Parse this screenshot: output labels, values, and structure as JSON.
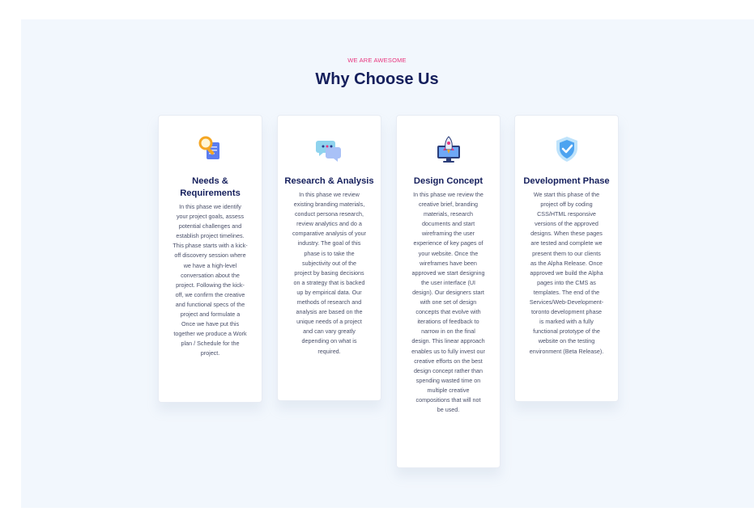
{
  "section": {
    "eyebrow": "WE ARE AWESOME",
    "title": "Why Choose Us"
  },
  "cards": [
    {
      "icon": "search-document-icon",
      "title": "Needs &\nRequirements",
      "text": "In this phase we identify\nyour project goals, assess\npotential challenges and\nestablish project timelines.\nThis phase starts with a kick-\noff discovery session where\nwe have a high-level\nconversation about the\nproject. Following the kick-\noff, we confirm the creative\nand functional specs of the\nproject and formulate a\nOnce we have put this\ntogether we produce a Work\nplan / Schedule for the\nproject."
    },
    {
      "icon": "chat-bubbles-icon",
      "title": "Research & Analysis",
      "text": "In this phase we review\nexisting branding materials,\nconduct persona research,\nreview analytics and do a\ncomparative analysis of your\nindustry. The goal of this\nphase is to take the\nsubjectivity out of the\nproject by basing decisions\non a strategy that is backed\nup by empirical data. Our\nmethods of research and\nanalysis are based on the\nunique needs of a project\nand can vary greatly\ndepending on what is\nrequired."
    },
    {
      "icon": "rocket-monitor-icon",
      "title": "Design Concept",
      "text": "In this phase we review the\ncreative brief, branding\nmaterials, research\ndocuments and start\nwireframing the user\nexperience of key pages of\nyour website. Once the\nwireframes have been\napproved we start designing\nthe user interface (UI\ndesign). Our designers start\nwith one set of design\nconcepts that evolve with\niterations of feedback to\nnarrow in on the final\ndesign. This linear approach\nenables us to fully invest our\ncreative efforts on the best\ndesign concept rather than\nspending wasted time on\nmultiple creative\ncompositions that will not\nbe used."
    },
    {
      "icon": "shield-check-icon",
      "title": "Development Phase",
      "text": "We start this phase of the\nproject off by coding\nCSS/HTML responsive\nversions of the approved\ndesigns. When these pages\nare tested and complete we\npresent them to our clients\nas the Alpha Release. Once\napproved we build the Alpha\npages into the CMS as\ntemplates. The end of the\nServices/Web-Development-\ntoronto development phase\nis marked with a fully\nfunctional prototype of the\nwebsite on the testing\nenvironment (Beta Release)."
    }
  ],
  "colors": {
    "accent": "#e8357e",
    "heading": "#151f5c",
    "section_bg": "#f2f7fd"
  }
}
